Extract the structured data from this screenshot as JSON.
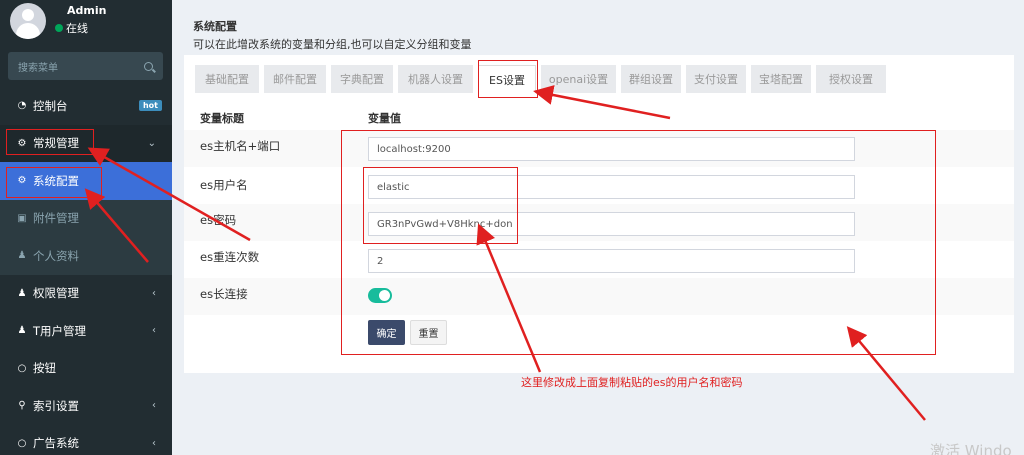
{
  "user": {
    "name": "Admin",
    "status": "在线"
  },
  "sidebar": {
    "search_placeholder": "搜索菜单",
    "items": [
      {
        "label": "控制台",
        "badge": "hot",
        "icon": "dashboard-icon"
      },
      {
        "label": "常规管理",
        "icon": "cogs-icon"
      },
      {
        "label": "系统配置",
        "icon": "gear-icon"
      },
      {
        "label": "附件管理",
        "icon": "image-icon"
      },
      {
        "label": "个人资料",
        "icon": "user-icon"
      },
      {
        "label": "权限管理",
        "icon": "group-icon"
      },
      {
        "label": "T用户管理",
        "icon": "user-icon"
      },
      {
        "label": "按钮",
        "icon": "circle-icon"
      },
      {
        "label": "索引设置",
        "icon": "search-icon"
      },
      {
        "label": "广告系统",
        "icon": "circle-icon"
      }
    ]
  },
  "page": {
    "title": "系统配置",
    "description": "可以在此增改系统的变量和分组,也可以自定义分组和变量"
  },
  "tabs": [
    "基础配置",
    "邮件配置",
    "字典配置",
    "机器人设置",
    "ES设置",
    "openai设置",
    "群组设置",
    "支付设置",
    "宝塔配置",
    "授权设置"
  ],
  "table": {
    "col_title": "变量标题",
    "col_value": "变量值",
    "rows": [
      {
        "label": "es主机名+端口",
        "value": "localhost:9200"
      },
      {
        "label": "es用户名",
        "value": "elastic"
      },
      {
        "label": "es密码",
        "value": "GR3nPvGwd+V8Hknc+don"
      },
      {
        "label": "es重连次数",
        "value": "2"
      },
      {
        "label": "es长连接",
        "value": ""
      }
    ]
  },
  "buttons": {
    "ok": "确定",
    "reset": "重置"
  },
  "annotation": "这里修改成上面复制粘贴的es的用户名和密码",
  "watermark": "激活 Windo",
  "colors": {
    "accent": "#3c6fd9",
    "sidebar": "#222d32",
    "annotation": "#e02020",
    "toggle": "#18bc9c"
  }
}
